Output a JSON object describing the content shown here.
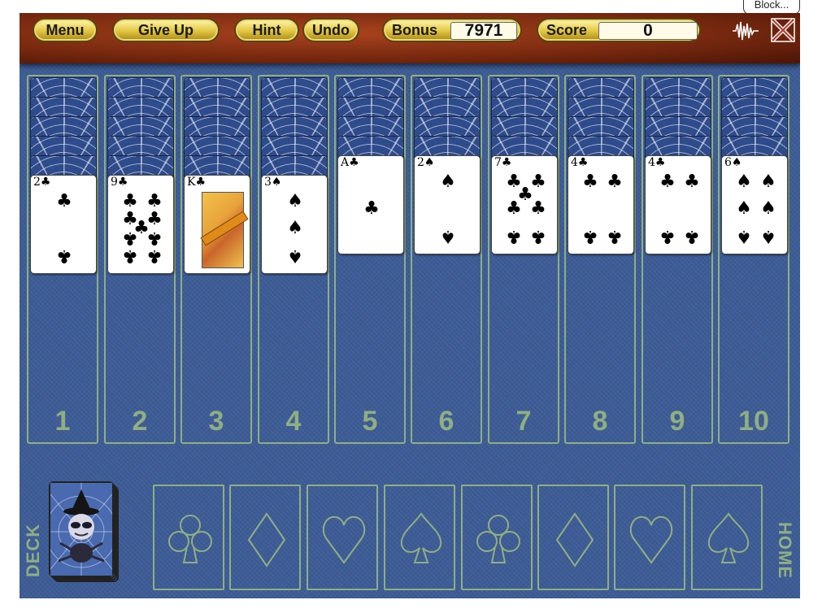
{
  "toolbar": {
    "menu_label": "Menu",
    "give_up_label": "Give Up",
    "hint_label": "Hint",
    "undo_label": "Undo",
    "bonus_label": "Bonus",
    "bonus_value": "7971",
    "score_label": "Score",
    "score_value": "0",
    "sound_icon": "sound-wave-icon",
    "close_icon": "close-x-icon"
  },
  "overlay": {
    "block_label": "Block..."
  },
  "tableau": {
    "columns": [
      {
        "number": "1",
        "facedown": 5,
        "card": {
          "rank": "2",
          "suit": "♣"
        }
      },
      {
        "number": "2",
        "facedown": 5,
        "card": {
          "rank": "9",
          "suit": "♣"
        }
      },
      {
        "number": "3",
        "facedown": 5,
        "card": {
          "rank": "K",
          "suit": "♣"
        }
      },
      {
        "number": "4",
        "facedown": 5,
        "card": {
          "rank": "3",
          "suit": "♠"
        }
      },
      {
        "number": "5",
        "facedown": 4,
        "card": {
          "rank": "A",
          "suit": "♣"
        }
      },
      {
        "number": "6",
        "facedown": 4,
        "card": {
          "rank": "2",
          "suit": "♠"
        }
      },
      {
        "number": "7",
        "facedown": 4,
        "card": {
          "rank": "7",
          "suit": "♣"
        }
      },
      {
        "number": "8",
        "facedown": 4,
        "card": {
          "rank": "4",
          "suit": "♣"
        }
      },
      {
        "number": "9",
        "facedown": 4,
        "card": {
          "rank": "4",
          "suit": "♣"
        }
      },
      {
        "number": "10",
        "facedown": 4,
        "card": {
          "rank": "6",
          "suit": "♠"
        }
      }
    ]
  },
  "deck": {
    "label": "DECK",
    "icon": "witch-spider-card-back-icon"
  },
  "home": {
    "label": "HOME",
    "slots": [
      "club",
      "diamond",
      "heart",
      "spade",
      "club",
      "diamond",
      "heart",
      "spade"
    ]
  },
  "colors": {
    "felt": "#3d5c96",
    "outline": "#8fae82",
    "toolbar": "#7a2a10",
    "button": "#e2c640"
  }
}
